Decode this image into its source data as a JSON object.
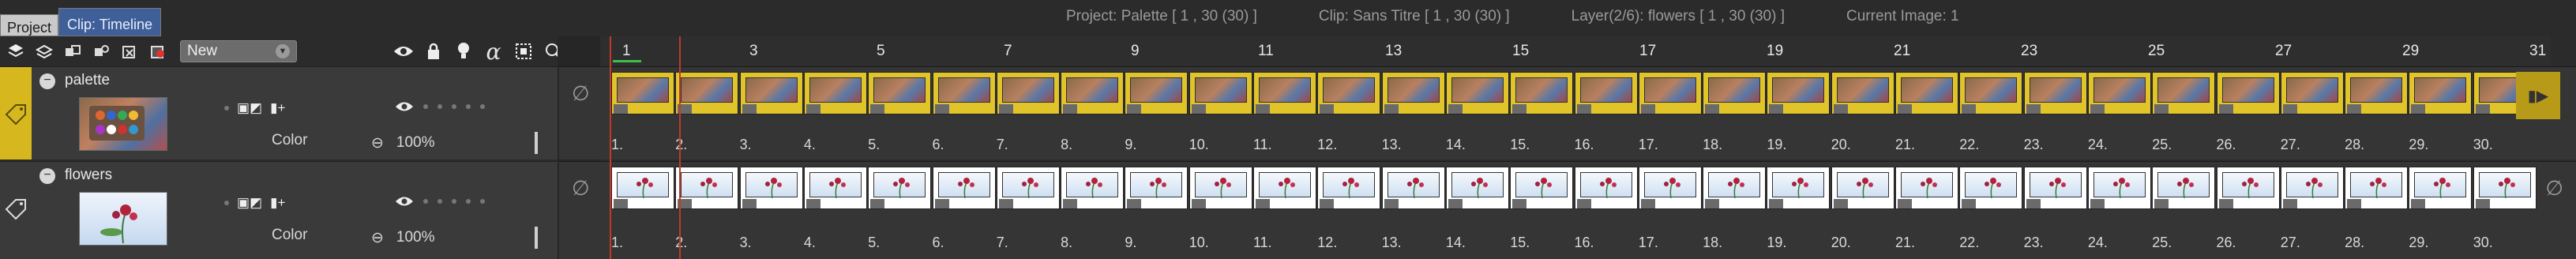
{
  "tabs": [
    {
      "label": "Project",
      "active": false
    },
    {
      "label": "Clip: Timeline",
      "active": true
    }
  ],
  "info": {
    "project": "Project: Palette [ 1 , 30  (30) ]",
    "clip": "Clip: Sans Titre [ 1 , 30  (30) ]",
    "layer": "Layer(2/6): flowers [ 1 , 30  (30) ]",
    "current": "Current Image: 1"
  },
  "toolbar": {
    "icons": [
      "layers-add-icon",
      "layers-duplicate-icon",
      "layer-group-icon",
      "layer-link-icon",
      "layer-clear-icon",
      "layer-color-icon"
    ],
    "dropdown_value": "New"
  },
  "column_icons": [
    "eye-icon",
    "lock-icon",
    "bulb-icon",
    "alpha-icon",
    "selection-icon",
    "magnify-icon"
  ],
  "ruler_numbers": [
    "1",
    "3",
    "5",
    "7",
    "9",
    "11",
    "13",
    "15",
    "17",
    "19",
    "21",
    "23",
    "25",
    "27",
    "29",
    "31"
  ],
  "layers": [
    {
      "name": "palette",
      "label": "Color",
      "opacity": "100%",
      "side_color": "#d6b81e",
      "frame_color": "#e0c429",
      "thumb": "palette"
    },
    {
      "name": "flowers",
      "label": "Color",
      "opacity": "100%",
      "side_color": "#4a4a4a",
      "frame_color": "#ffffff",
      "thumb": "flowers"
    }
  ],
  "frame_numbers": [
    "1.",
    "2.",
    "3.",
    "4.",
    "5.",
    "6.",
    "7.",
    "8.",
    "9.",
    "10.",
    "11.",
    "12.",
    "13.",
    "14.",
    "15.",
    "16.",
    "17.",
    "18.",
    "19.",
    "20.",
    "21.",
    "22.",
    "23.",
    "24.",
    "25.",
    "26.",
    "27.",
    "28.",
    "29.",
    "30."
  ],
  "colors": {
    "accent": "#3f5f98",
    "palette_frame": "#e0c429",
    "playhead": "#c0392b",
    "marker": "#3ec14a"
  }
}
